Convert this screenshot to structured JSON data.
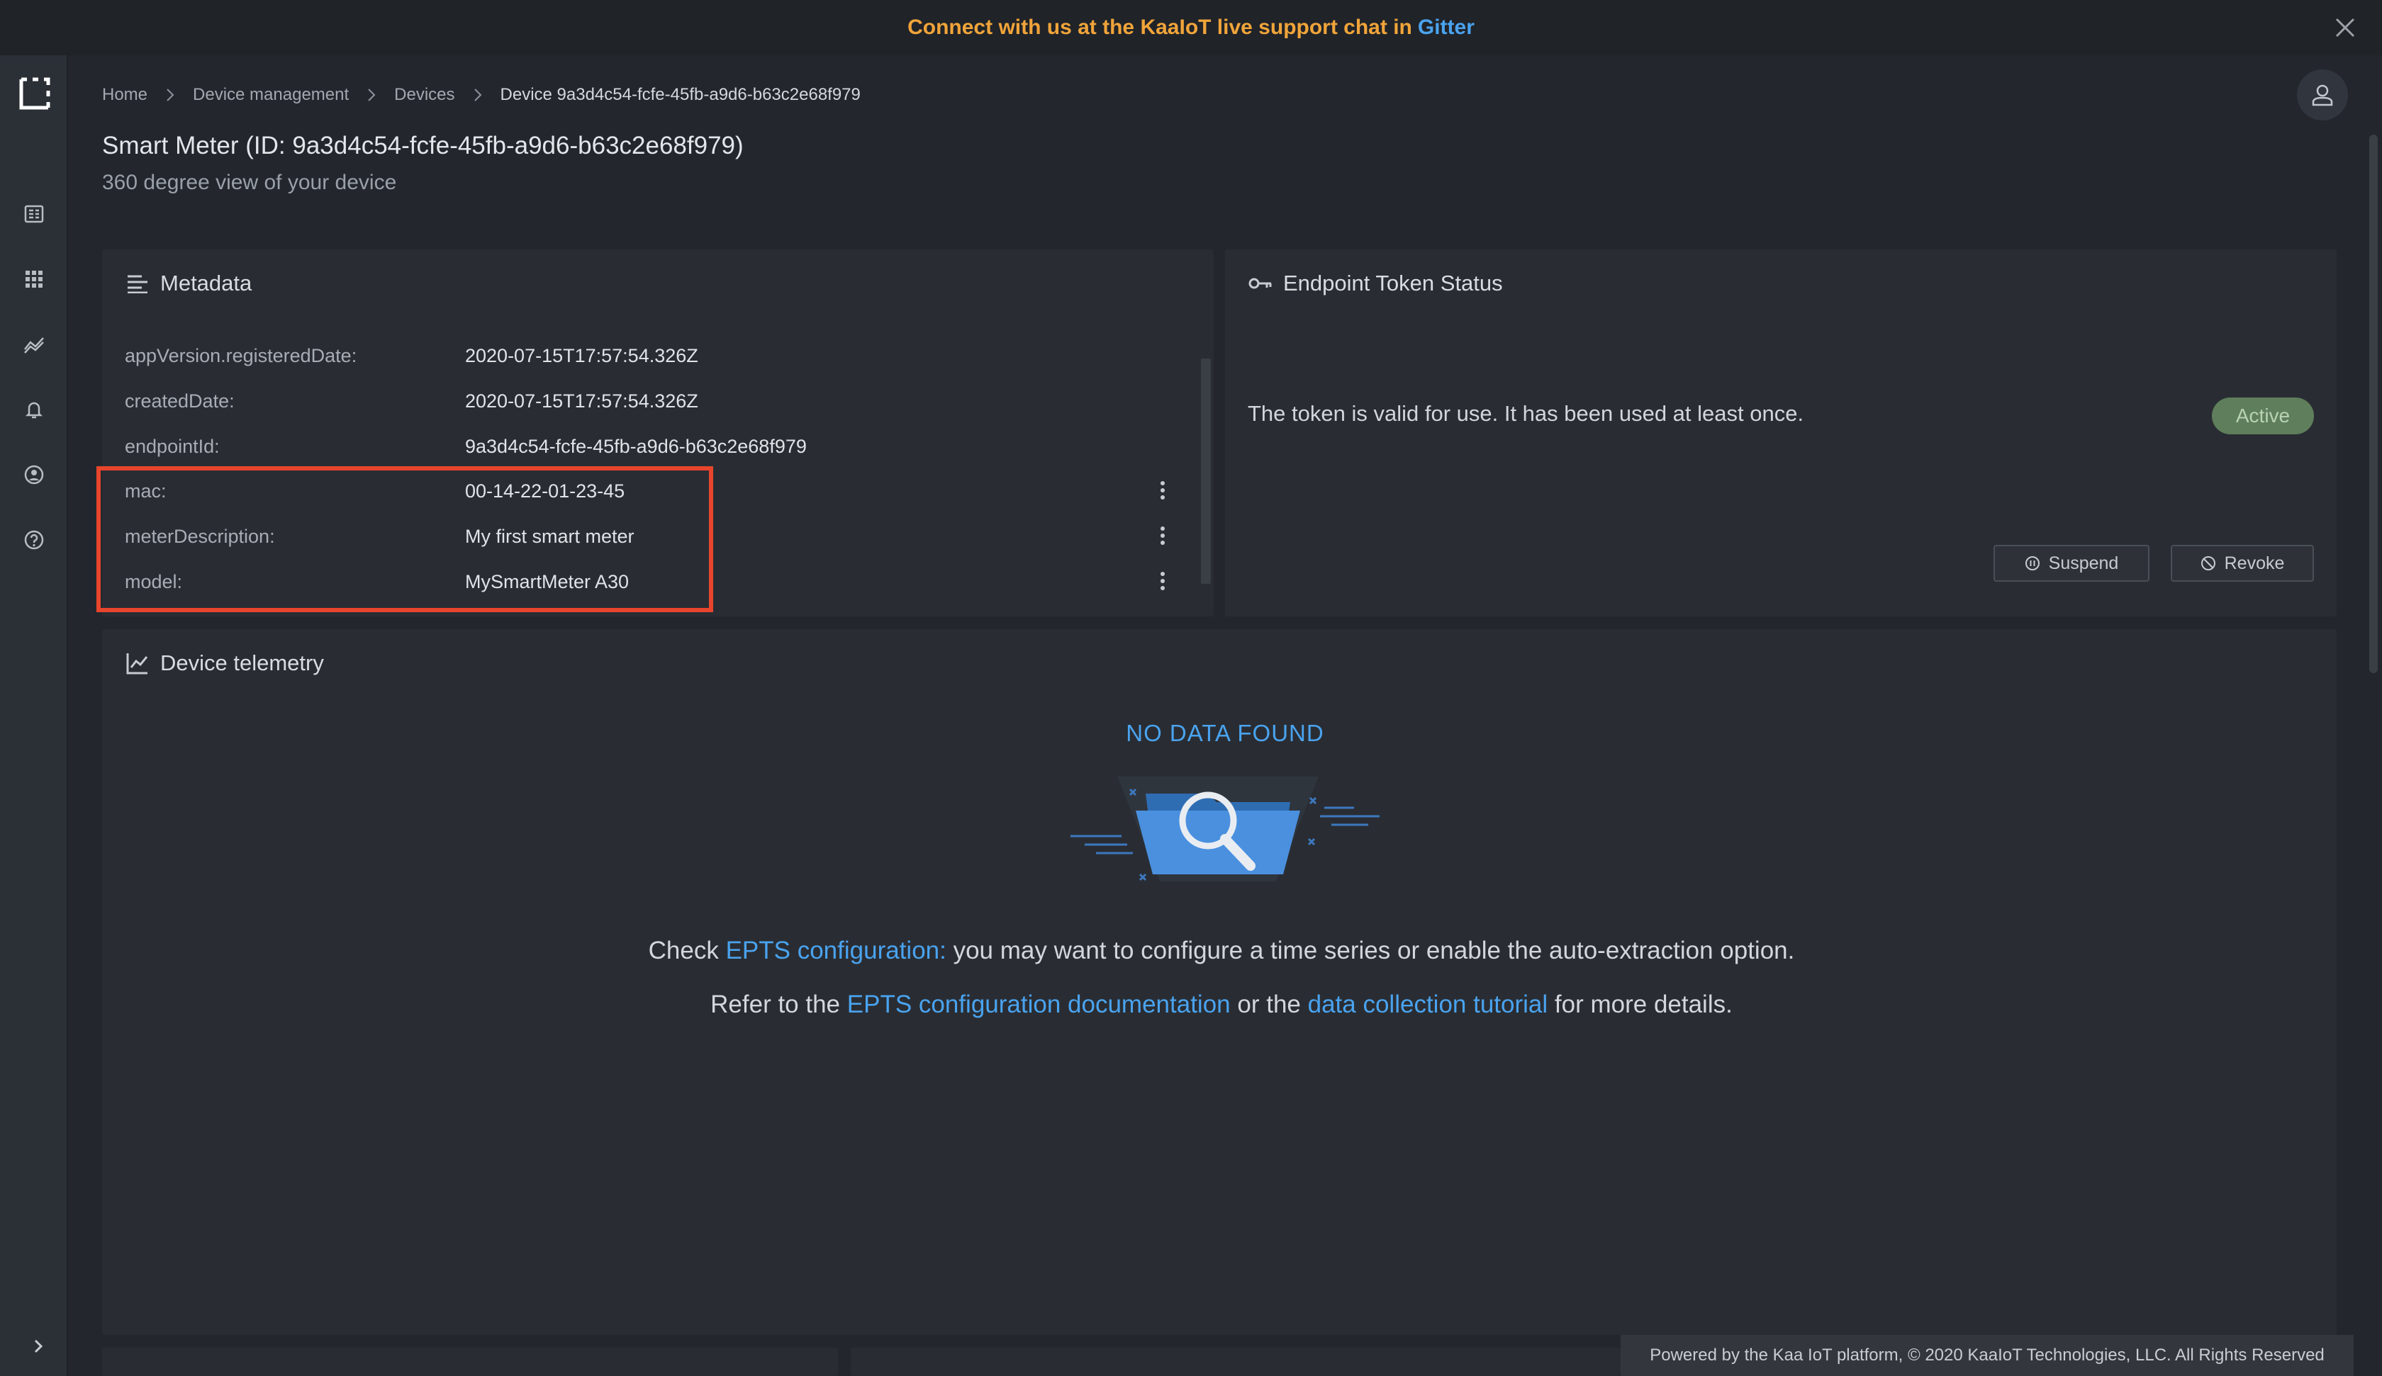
{
  "banner": {
    "text": "Connect with us at the KaaIoT live support chat in",
    "link": "Gitter"
  },
  "breadcrumb": [
    "Home",
    "Device management",
    "Devices",
    "Device 9a3d4c54-fcfe-45fb-a9d6-b63c2e68f979"
  ],
  "header": {
    "title": "Smart Meter (ID: 9a3d4c54-fcfe-45fb-a9d6-b63c2e68f979)",
    "subtitle": "360 degree view of your device"
  },
  "sidebar": {
    "items": [
      "dashboard-icon",
      "apps-grid-icon",
      "analytics-icon",
      "bell-icon",
      "account-icon",
      "help-icon"
    ]
  },
  "metadata": {
    "title": "Metadata",
    "rows": [
      {
        "key": "appVersion.registeredDate:",
        "value": "2020-07-15T17:57:54.326Z"
      },
      {
        "key": "createdDate:",
        "value": "2020-07-15T17:57:54.326Z"
      },
      {
        "key": "endpointId:",
        "value": "9a3d4c54-fcfe-45fb-a9d6-b63c2e68f979"
      },
      {
        "key": "mac:",
        "value": "00-14-22-01-23-45"
      },
      {
        "key": "meterDescription:",
        "value": "My first smart meter"
      },
      {
        "key": "model:",
        "value": "MySmartMeter A30"
      }
    ]
  },
  "token": {
    "title": "Endpoint Token Status",
    "text": "The token is valid for use. It has been used at least once.",
    "status": "Active",
    "suspend_label": "Suspend",
    "revoke_label": "Revoke"
  },
  "telemetry": {
    "title": "Device telemetry",
    "no_data": "NO DATA FOUND",
    "line1": {
      "prefix": "Check",
      "link": "EPTS configuration:",
      "suffix": "you may want to configure a time series or enable the auto-extraction option."
    },
    "line2": {
      "prefix": "Refer to the",
      "link1": "EPTS configuration documentation",
      "middle": "or the",
      "link2": "data collection tutorial",
      "suffix": "for more details."
    }
  },
  "footer": "Powered by the Kaa IoT platform, © 2020 KaaIoT Technologies, LLC. All Rights Reserved",
  "colors": {
    "accent": "#4aa3ef",
    "banner_text": "#f0a43a",
    "highlight": "#e8452c",
    "active_badge": "#5f7e5c"
  }
}
